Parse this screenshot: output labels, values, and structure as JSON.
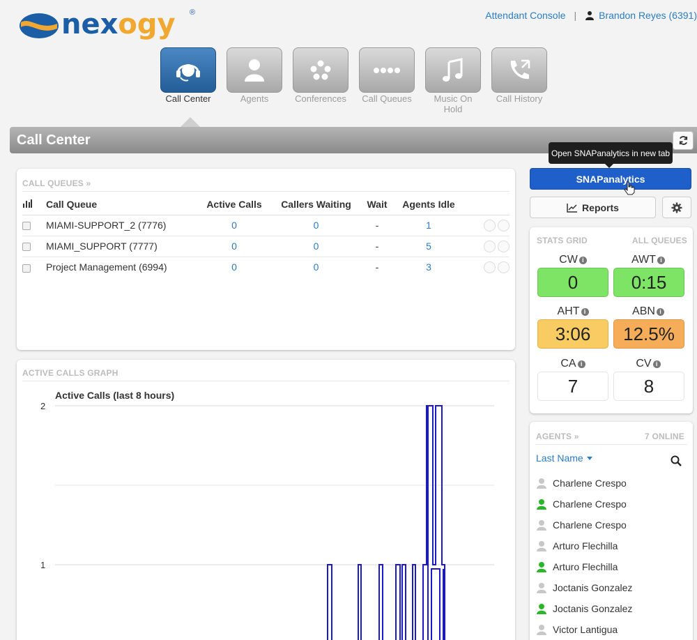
{
  "header": {
    "brand_name_part1": "nex",
    "brand_name_part2": "ogy",
    "brand_reg": "®",
    "attendant_console": "Attendant Console",
    "separator": "|",
    "user_label": "Brandon Reyes (6391)"
  },
  "nav": {
    "tiles": [
      {
        "label": "Call Center",
        "icon": "headset-icon",
        "active": true
      },
      {
        "label": "Agents",
        "icon": "person-icon",
        "active": false
      },
      {
        "label": "Conferences",
        "icon": "conference-dots-icon",
        "active": false
      },
      {
        "label": "Call Queues",
        "icon": "queue-dots-icon",
        "active": false
      },
      {
        "label": "Music On Hold",
        "icon": "music-note-icon",
        "active": false
      },
      {
        "label": "Call History",
        "icon": "phone-history-icon",
        "active": false
      }
    ]
  },
  "page": {
    "title": "Call Center"
  },
  "call_queues": {
    "heading": "CALL QUEUES »",
    "columns": [
      "Call Queue",
      "Active Calls",
      "Callers Waiting",
      "Wait",
      "Agents Idle"
    ],
    "rows": [
      {
        "name": "MIAMI-SUPPORT_2 (7776)",
        "active_calls": "0",
        "callers_waiting": "0",
        "wait": "-",
        "agents_idle": "1"
      },
      {
        "name": "MIAMI_SUPPORT (7777)",
        "active_calls": "0",
        "callers_waiting": "0",
        "wait": "-",
        "agents_idle": "5"
      },
      {
        "name": "Project Management (6994)",
        "active_calls": "0",
        "callers_waiting": "0",
        "wait": "-",
        "agents_idle": "3"
      }
    ]
  },
  "graph_panel": {
    "heading": "ACTIVE CALLS GRAPH"
  },
  "chart_data": {
    "type": "line",
    "title": "Active Calls (last 8 hours)",
    "y_ticks": [
      "2",
      "1"
    ],
    "ylim": [
      0,
      2
    ],
    "series_color": "#1a1acc"
  },
  "sidebar": {
    "tooltip": "Open SNAPanalytics in new tab",
    "snap_button": "SNAPanalytics",
    "reports_button": "Reports",
    "stats": {
      "heading_left": "STATS GRID",
      "heading_right": "ALL QUEUES",
      "items": [
        {
          "label": "CW",
          "value": "0",
          "color": "green"
        },
        {
          "label": "AWT",
          "value": "0:15",
          "color": "green"
        },
        {
          "label": "AHT",
          "value": "3:06",
          "color": "yellow"
        },
        {
          "label": "ABN",
          "value": "12.5%",
          "color": "orange"
        },
        {
          "label": "CA",
          "value": "7",
          "color": "plain"
        },
        {
          "label": "CV",
          "value": "8",
          "color": "plain"
        }
      ]
    },
    "agents": {
      "heading_left": "AGENTS »",
      "heading_right": "7 ONLINE",
      "sort_label": "Last Name",
      "list": [
        {
          "name": "Charlene Crespo",
          "status": "offline"
        },
        {
          "name": "Charlene Crespo",
          "status": "online"
        },
        {
          "name": "Charlene Crespo",
          "status": "offline"
        },
        {
          "name": "Arturo Flechilla",
          "status": "offline"
        },
        {
          "name": "Arturo Flechilla",
          "status": "online"
        },
        {
          "name": "Joctanis Gonzalez",
          "status": "offline"
        },
        {
          "name": "Joctanis Gonzalez",
          "status": "online"
        },
        {
          "name": "Victor Lantigua",
          "status": "offline"
        }
      ]
    }
  },
  "colors": {
    "accent": "#2a7cc4",
    "snap_button": "#1e5fc9",
    "active_tile": "#245d97",
    "online_green": "#2bb52b",
    "offline_gray": "#c8c8c8"
  }
}
